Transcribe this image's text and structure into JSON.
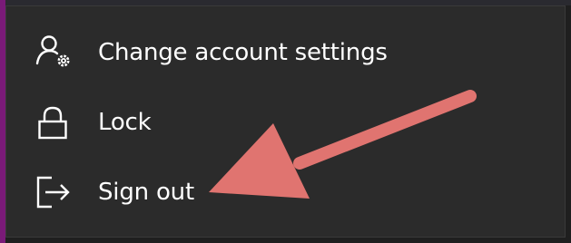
{
  "menu": {
    "items": [
      {
        "label": "Change account settings",
        "icon": "account-settings-icon"
      },
      {
        "label": "Lock",
        "icon": "lock-icon"
      },
      {
        "label": "Sign out",
        "icon": "sign-out-icon"
      }
    ]
  },
  "annotation": {
    "type": "arrow",
    "points_to": "Sign out",
    "color": "#e07470"
  },
  "colors": {
    "menu_background": "#2b2b2b",
    "text": "#ffffff",
    "accent": "#7a1a78"
  }
}
